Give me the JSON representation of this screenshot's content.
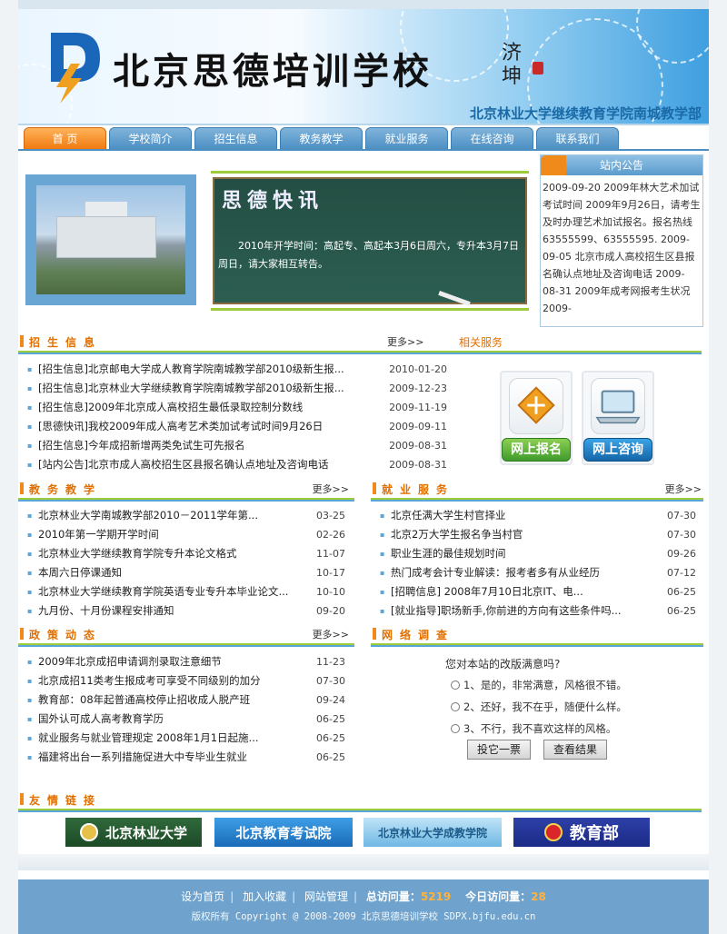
{
  "banner": {
    "logo_letters": "D",
    "title": "北京思德培训学校",
    "script": "济坤",
    "subtitle": "北京林业大学继续教育学院南城教学部"
  },
  "nav": [
    {
      "label": "首  页",
      "active": true
    },
    {
      "label": "学校简介"
    },
    {
      "label": "招生信息"
    },
    {
      "label": "教务教学"
    },
    {
      "label": "就业服务"
    },
    {
      "label": "在线咨询"
    },
    {
      "label": "联系我们"
    }
  ],
  "featured": {
    "board_title": "思德快讯",
    "board_text": "2010年开学时间：高起专、高起本3月6日周六，专升本3月7日周日，请大家相互转告。"
  },
  "notice": {
    "title": "站内公告",
    "text": "2009-09-20 2009年林大艺术加试考试时间 2009年9月26日，请考生及时办理艺术加试报名。报名热线63555599、63555595. 2009-09-05 北京市成人高校招生区县报名确认点地址及咨询电话 2009-08-31 2009年成考网报考生状况 2009-"
  },
  "enroll": {
    "title": "招生信息",
    "more": "更多>>",
    "related": "相关服务",
    "items": [
      {
        "tag": "[招生信息]",
        "text": "北京邮电大学成人教育学院南城教学部2010级新生报...",
        "date": "2010-01-20"
      },
      {
        "tag": "[招生信息]",
        "text": "北京林业大学继续教育学院南城教学部2010级新生报...",
        "date": "2009-12-23"
      },
      {
        "tag": "[招生信息]",
        "text": "2009年北京成人高校招生最低录取控制分数线",
        "date": "2009-11-19"
      },
      {
        "tag": "[思德快讯]",
        "text": "我校2009年成人高考艺术类加试考试时间9月26日",
        "date": "2009-09-11"
      },
      {
        "tag": "[招生信息]",
        "text": "今年成招新增两类免试生可先报名",
        "date": "2009-08-31"
      },
      {
        "tag": "[站内公告]",
        "text": "北京市成人高校招生区县报名确认点地址及咨询电话",
        "date": "2009-08-31"
      }
    ]
  },
  "services": {
    "register": "网上报名",
    "consult": "网上咨询"
  },
  "teaching": {
    "title": "教务教学",
    "more": "更多>>",
    "items": [
      {
        "text": "北京林业大学南城教学部2010－2011学年第...",
        "date": "03-25"
      },
      {
        "text": "2010年第一学期开学时间",
        "date": "02-26"
      },
      {
        "text": "北京林业大学继续教育学院专升本论文格式",
        "date": "11-07"
      },
      {
        "text": "本周六日停课通知",
        "date": "10-17"
      },
      {
        "text": "北京林业大学继续教育学院英语专业专升本毕业论文...",
        "date": "10-10"
      },
      {
        "text": "九月份、十月份课程安排通知",
        "date": "09-20"
      }
    ]
  },
  "employment": {
    "title": "就业服务",
    "more": "更多>>",
    "items": [
      {
        "text": "北京任满大学生村官择业",
        "date": "07-30"
      },
      {
        "text": "北京2万大学生报名争当村官",
        "date": "07-30"
      },
      {
        "text": "职业生涯的最佳规划时间",
        "date": "09-26"
      },
      {
        "text": "热门成考会计专业解读：报考者多有从业经历",
        "date": "07-12"
      },
      {
        "text": "[招聘信息] 2008年7月10日北京IT、电...",
        "date": "06-25"
      },
      {
        "text": "[就业指导]职场新手,你前进的方向有这些条件吗...",
        "date": "06-25"
      }
    ]
  },
  "policy": {
    "title": "政策动态",
    "more": "更多>>",
    "items": [
      {
        "text": "2009年北京成招申请调剂录取注意细节",
        "date": "11-23"
      },
      {
        "text": "北京成招11类考生报成考可享受不同级别的加分",
        "date": "07-30"
      },
      {
        "text": "教育部：08年起普通高校停止招收成人脱产班",
        "date": "09-24"
      },
      {
        "text": "国外认可成人高考教育学历",
        "date": "06-25"
      },
      {
        "text": "就业服务与就业管理规定 2008年1月1日起施...",
        "date": "06-25"
      },
      {
        "text": "福建将出台一系列措施促进大中专毕业生就业",
        "date": "06-25"
      }
    ]
  },
  "survey": {
    "title": "网络调查",
    "question": "您对本站的改版满意吗?",
    "options": [
      "1、是的，非常满意，风格很不错。",
      "2、还好，我不在乎，随便什么样。",
      "3、不行，我不喜欢这样的风格。"
    ],
    "vote": "投它一票",
    "results": "查看结果"
  },
  "links": {
    "title": "友情链接",
    "bjfu": "北京林业大学",
    "bjeea": "北京教育考试院",
    "adult": "北京林业大学成教学院",
    "moe": "教育部"
  },
  "footer": {
    "home": "设为首页",
    "fav": "加入收藏",
    "admin": "网站管理",
    "total_label": "总访问量：",
    "total": "5219",
    "today_label": "今日访问量：",
    "today": "28",
    "copyright": "版权所有 Copyright @ 2008-2009 北京思德培训学校 SDPX.bjfu.edu.cn"
  },
  "colors": {
    "accent": "#e27000",
    "nav": "#4d8fc3",
    "green": "#9ccc3c"
  }
}
